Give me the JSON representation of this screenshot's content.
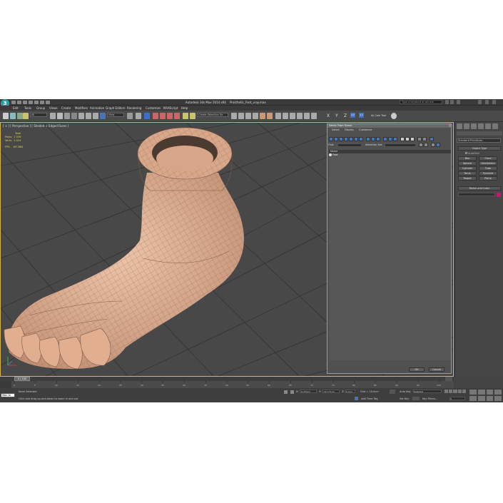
{
  "app": {
    "title": "Autodesk 3ds Max 2014 x64",
    "file": "Prosthetic_Foot_vray.max",
    "search_placeholder": "Type a keyword or phrase",
    "logo": "3"
  },
  "menu": [
    "Edit",
    "Tools",
    "Group",
    "Views",
    "Create",
    "Modifiers",
    "Animation",
    "Graph Editors",
    "Rendering",
    "Customize",
    "MAXScript",
    "Help"
  ],
  "toolbar": {
    "filter": "All",
    "ref_coord": "View",
    "selection_set": "Create Selection Se",
    "axis": [
      "X",
      "Y",
      "Z",
      "XY",
      "XY"
    ],
    "key_tool": "ify Cam Tool"
  },
  "viewport": {
    "label": "[ + ] [ Perspective ] [ Shaded + Edged Faces ]",
    "stats": {
      "total": "Total",
      "polys_label": "Polys:",
      "polys": "2 036",
      "verts_label": "Verts:",
      "verts": "1 024",
      "fps_label": "FPS:",
      "fps": "167.684"
    }
  },
  "scene_explorer": {
    "title": "Select From Scene",
    "menus": [
      "Select",
      "Display",
      "Customize"
    ],
    "find_label": "Find:",
    "selection_set_label": "Selection Set:",
    "column": "Name",
    "rows": [
      "Foot"
    ],
    "ok": "OK",
    "cancel": "Cancel"
  },
  "command_panel": {
    "dropdown": "Standard Primitives",
    "object_type": "Object Type",
    "autogrid": "AutoGrid",
    "objects": [
      "Box",
      "Cone",
      "Sphere",
      "GeoSphere",
      "Cylinder",
      "Tube",
      "Torus",
      "Pyramid",
      "Teapot",
      "Plane"
    ],
    "name_and_color": "Name and Color",
    "object_color": "#c2186e"
  },
  "timeline": {
    "frame": "0 / 100",
    "ticks": [
      "0",
      "5",
      "10",
      "15",
      "20",
      "25",
      "30",
      "35",
      "40",
      "45",
      "50",
      "55",
      "60",
      "65",
      "70",
      "75",
      "80",
      "85",
      "90",
      "95",
      "100"
    ]
  },
  "status": {
    "maxscript": "Max to",
    "selection": "None Selected",
    "prompt": "Click and drag up-and-down to zoom in and out",
    "x_label": "X:",
    "x": "-6.253cm",
    "y_label": "Y:",
    "y": "-32.771cm",
    "z_label": "Z:",
    "z": "0.0cm",
    "grid": "Grid = 10.0cm",
    "auto_key": "Auto Key",
    "selected": "Selected",
    "set_key": "Set Key",
    "key_filters": "Key Filters...",
    "add_time_tag": "Add Time Tag",
    "frame_value": "0"
  },
  "colors": {
    "skin": "#e6b598",
    "viewport_border": "#d8b54a",
    "stats": "#e5d94a"
  }
}
